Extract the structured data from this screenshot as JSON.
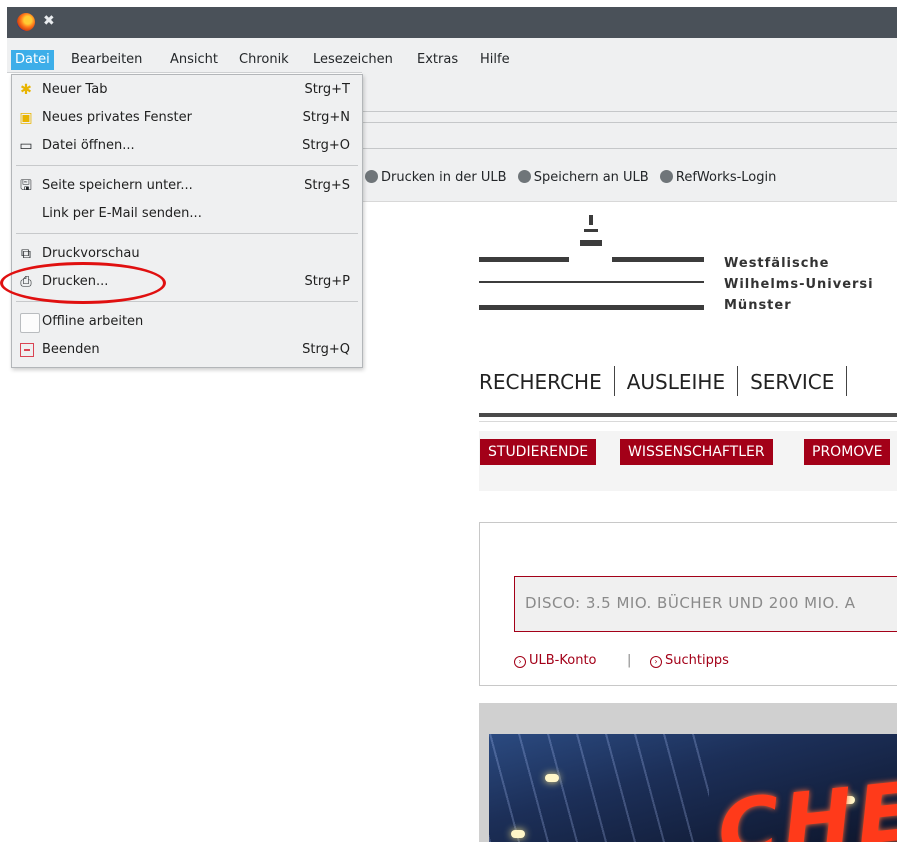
{
  "menubar": {
    "items": [
      "Datei",
      "Bearbeiten",
      "Ansicht",
      "Chronik",
      "Lesezeichen",
      "Extras",
      "Hilfe"
    ]
  },
  "file_menu": {
    "items": [
      {
        "label": "Neuer Tab",
        "shortcut": "Strg+T",
        "icon": "new-tab-icon"
      },
      {
        "label": "Neues privates Fenster",
        "shortcut": "Strg+N",
        "icon": "private-window-icon"
      },
      {
        "label": "Datei öffnen...",
        "shortcut": "Strg+O",
        "icon": "folder-icon"
      },
      {
        "label": "Seite speichern unter...",
        "shortcut": "Strg+S",
        "icon": "save-icon"
      },
      {
        "label": "Link per E-Mail senden...",
        "shortcut": ""
      },
      {
        "label": "Druckvorschau",
        "shortcut": "",
        "icon": "print-preview-icon"
      },
      {
        "label": "Drucken...",
        "shortcut": "Strg+P",
        "icon": "printer-icon"
      },
      {
        "label": "Offline arbeiten",
        "shortcut": "",
        "checked": false
      },
      {
        "label": "Beenden",
        "shortcut": "Strg+Q",
        "icon": "quit-icon"
      }
    ]
  },
  "bookmarks": {
    "items": [
      "Drucken in der ULB",
      "Speichern an ULB",
      "RefWorks-Login"
    ]
  },
  "site": {
    "logo_lines": [
      "Westfälische",
      "Wilhelms-Universi",
      "Münster"
    ],
    "nav": [
      "RECHERCHE",
      "AUSLEIHE",
      "SERVICE"
    ],
    "audience_tags": [
      "STUDIERENDE",
      "WISSENSCHAFTLER",
      "PROMOVE"
    ],
    "search_placeholder": "DISCO: 3.5 MIO. BÜCHER UND 200 MIO. A",
    "links": [
      "ULB-Konto",
      "Suchtipps"
    ],
    "link_separator": "|"
  },
  "colors": {
    "accent_red": "#a30018",
    "menu_highlight": "#3daee9",
    "annotation_ellipse": "#e01010"
  }
}
